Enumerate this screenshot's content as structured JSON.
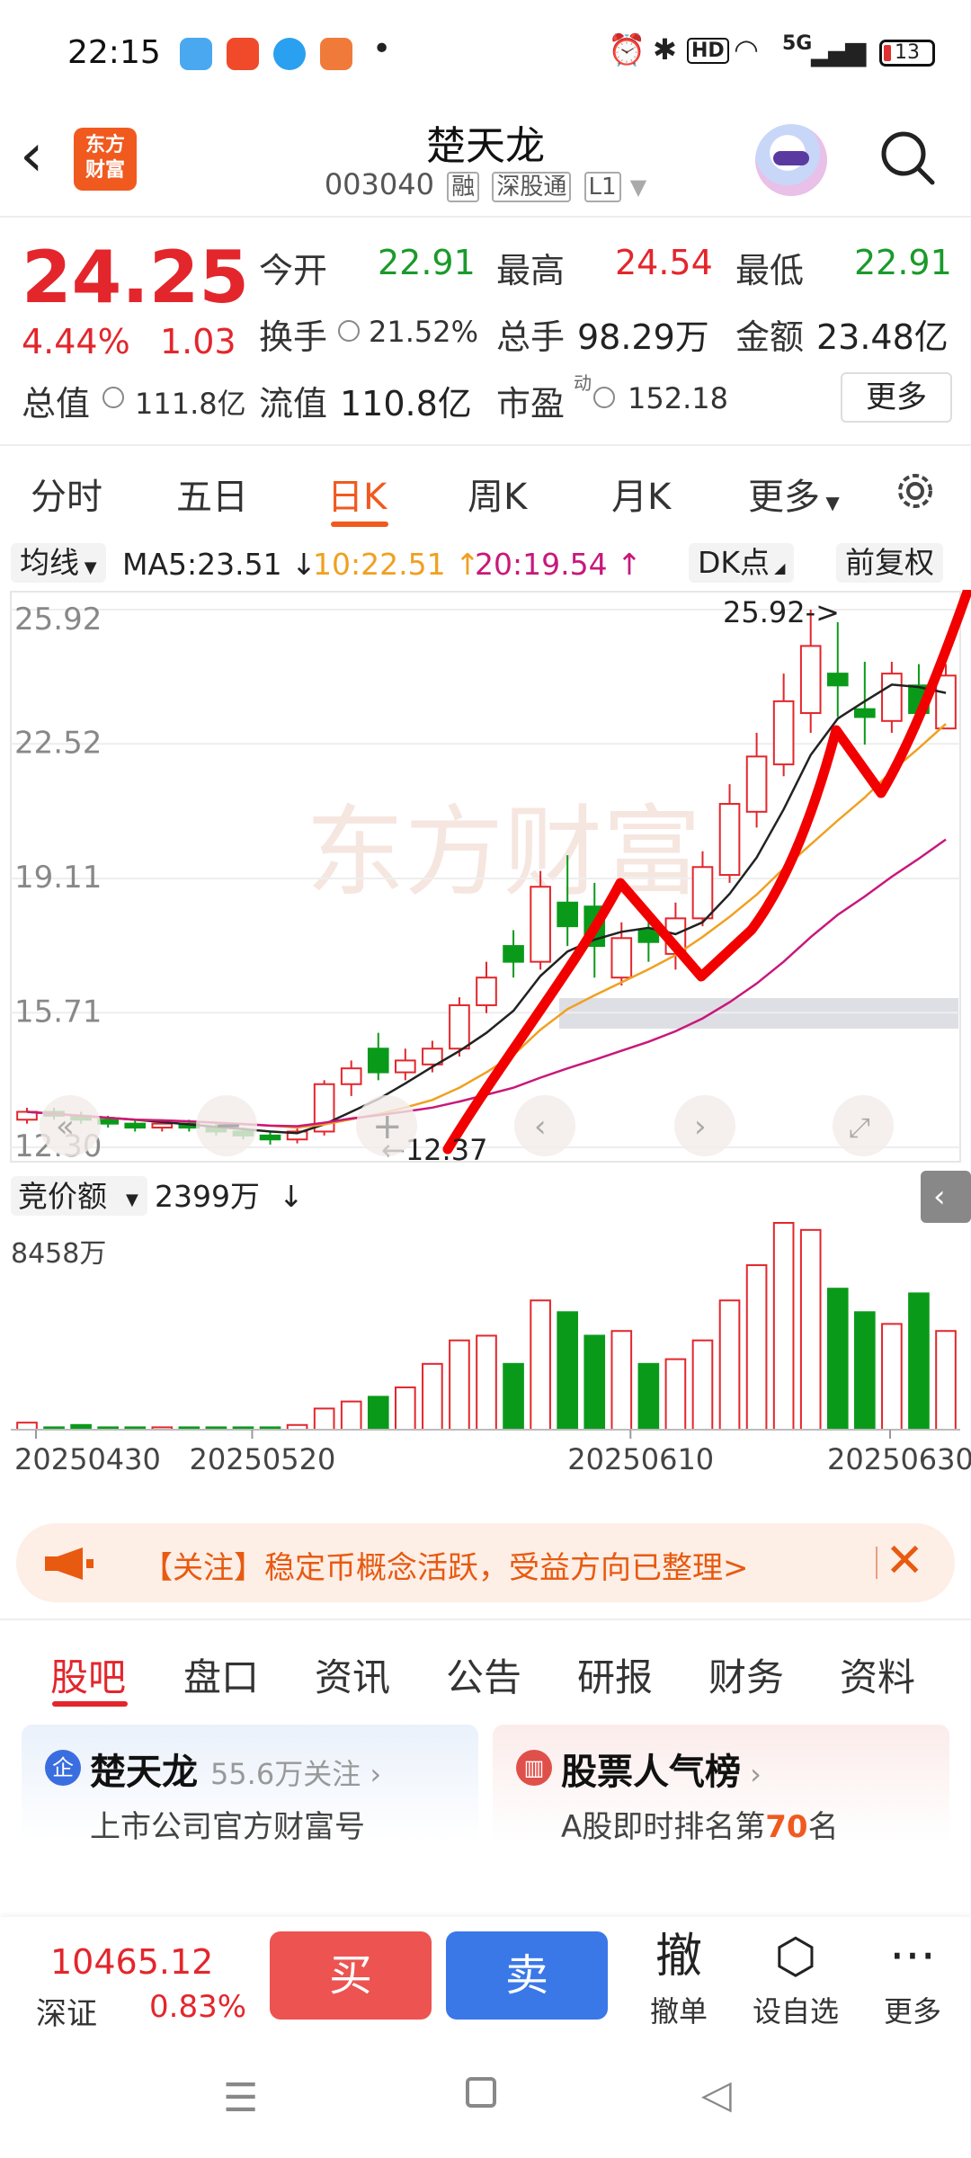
{
  "status_bar": {
    "time": "22:15",
    "dot": "•",
    "hd": "HD",
    "network": "5G",
    "battery": "13"
  },
  "header": {
    "title": "楚天龙",
    "code": "003040",
    "tags": [
      "融",
      "深股通",
      "L1"
    ],
    "logo_text": [
      "东方",
      "财富"
    ]
  },
  "quote": {
    "price": "24.25",
    "change_pct": "4.44%",
    "change": "1.03",
    "open_label": "今开",
    "open": "22.91",
    "high_label": "最高",
    "high": "24.54",
    "low_label": "最低",
    "low": "22.91",
    "turnover_label": "换手",
    "turnover": "21.52%",
    "volume_label": "总手",
    "volume": "98.29万",
    "amount_label": "金额",
    "amount": "23.48亿",
    "mcap_label": "总值",
    "mcap": "111.8亿",
    "float_label": "流值",
    "float": "110.8亿",
    "pe_label": "市盈",
    "pe_sup": "动",
    "pe": "152.18",
    "more": "更多"
  },
  "chart_tabs": [
    "分时",
    "五日",
    "日K",
    "周K",
    "月K",
    "更多"
  ],
  "chart_tab_active": 2,
  "ma_bar": {
    "mode": "均线",
    "ma5": "MA5:23.51",
    "ma10": "10:22.51",
    "ma20": "20:19.54",
    "dk": "DK点",
    "adjust": "前复权"
  },
  "chart_data": {
    "type": "candlestick",
    "price_ticks": [
      "25.92",
      "22.52",
      "19.11",
      "15.71",
      "12.30"
    ],
    "ylim": [
      12.3,
      25.92
    ],
    "max_label": "25.92->",
    "min_label": "←12.37",
    "dates": [
      "20250430",
      "20250520",
      "20250610",
      "20250630"
    ],
    "volume_selector": "竞价额",
    "volume_value": "2399万",
    "volume_max_label": "8458万",
    "candles": [
      {
        "o": 13.0,
        "c": 13.2,
        "h": 13.3,
        "l": 12.9
      },
      {
        "o": 13.2,
        "c": 13.1,
        "h": 13.3,
        "l": 13.0
      },
      {
        "o": 13.1,
        "c": 13.0,
        "h": 13.2,
        "l": 12.9
      },
      {
        "o": 13.0,
        "c": 12.9,
        "h": 13.1,
        "l": 12.8
      },
      {
        "o": 12.9,
        "c": 12.8,
        "h": 13.0,
        "l": 12.7
      },
      {
        "o": 12.8,
        "c": 12.9,
        "h": 13.0,
        "l": 12.7
      },
      {
        "o": 12.9,
        "c": 12.8,
        "h": 13.0,
        "l": 12.7
      },
      {
        "o": 12.8,
        "c": 12.7,
        "h": 12.9,
        "l": 12.6
      },
      {
        "o": 12.7,
        "c": 12.6,
        "h": 12.8,
        "l": 12.5
      },
      {
        "o": 12.6,
        "c": 12.5,
        "h": 12.7,
        "l": 12.37
      },
      {
        "o": 12.5,
        "c": 12.7,
        "h": 12.8,
        "l": 12.4
      },
      {
        "o": 12.7,
        "c": 13.9,
        "h": 14.0,
        "l": 12.6
      },
      {
        "o": 13.9,
        "c": 14.3,
        "h": 14.5,
        "l": 13.6
      },
      {
        "o": 14.8,
        "c": 14.2,
        "h": 15.2,
        "l": 14.0
      },
      {
        "o": 14.2,
        "c": 14.5,
        "h": 14.8,
        "l": 14.0
      },
      {
        "o": 14.4,
        "c": 14.8,
        "h": 15.0,
        "l": 14.2
      },
      {
        "o": 14.8,
        "c": 15.9,
        "h": 16.1,
        "l": 14.6
      },
      {
        "o": 15.9,
        "c": 16.6,
        "h": 17.0,
        "l": 15.7
      },
      {
        "o": 17.4,
        "c": 17.0,
        "h": 17.8,
        "l": 16.6
      },
      {
        "o": 17.0,
        "c": 18.9,
        "h": 19.3,
        "l": 16.8
      },
      {
        "o": 18.5,
        "c": 17.9,
        "h": 19.7,
        "l": 17.4
      },
      {
        "o": 18.4,
        "c": 17.4,
        "h": 19.0,
        "l": 16.6
      },
      {
        "o": 16.6,
        "c": 17.6,
        "h": 18.0,
        "l": 16.4
      },
      {
        "o": 17.8,
        "c": 17.5,
        "h": 18.3,
        "l": 17.0
      },
      {
        "o": 17.2,
        "c": 18.1,
        "h": 18.5,
        "l": 16.8
      },
      {
        "o": 18.1,
        "c": 19.4,
        "h": 19.8,
        "l": 17.9
      },
      {
        "o": 19.2,
        "c": 21.0,
        "h": 21.5,
        "l": 19.0
      },
      {
        "o": 20.8,
        "c": 22.2,
        "h": 22.8,
        "l": 20.4
      },
      {
        "o": 22.0,
        "c": 23.6,
        "h": 24.3,
        "l": 21.7
      },
      {
        "o": 23.3,
        "c": 25.0,
        "h": 25.92,
        "l": 22.8
      },
      {
        "o": 24.3,
        "c": 24.0,
        "h": 25.6,
        "l": 23.2
      },
      {
        "o": 23.4,
        "c": 23.2,
        "h": 24.6,
        "l": 22.5
      },
      {
        "o": 23.1,
        "c": 24.3,
        "h": 24.6,
        "l": 22.8
      },
      {
        "o": 24.0,
        "c": 23.3,
        "h": 24.54,
        "l": 22.91
      },
      {
        "o": 22.91,
        "c": 24.25,
        "h": 24.54,
        "l": 22.91
      }
    ],
    "volumes": [
      3,
      1,
      2,
      1,
      1,
      1,
      1,
      1,
      1,
      1,
      2,
      9,
      12,
      14,
      18,
      28,
      38,
      40,
      28,
      55,
      50,
      40,
      42,
      28,
      30,
      38,
      55,
      70,
      88,
      85,
      60,
      50,
      45,
      58,
      42
    ]
  },
  "notice": {
    "text": "【关注】稳定币概念活跃，受益方向已整理>"
  },
  "bottom_tabs": [
    "股吧",
    "盘口",
    "资讯",
    "公告",
    "研报",
    "财务",
    "资料"
  ],
  "bottom_tab_active": 0,
  "card1": {
    "badge": "企",
    "name": "楚天龙",
    "followers": "55.6万关注",
    "sub": "上市公司官方财富号"
  },
  "card2": {
    "name": "股票人气榜",
    "sub_prefix": "A股即时排名第",
    "rank": "70",
    "sub_suffix": "名"
  },
  "trade_bar": {
    "index_value": "10465.12",
    "index_name": "深证",
    "index_pct": "0.83%",
    "buy": "买",
    "sell": "卖",
    "cancel_glyph": "撤",
    "cancel_label": "撤单",
    "watch_label": "设自选",
    "more_label": "更多"
  }
}
